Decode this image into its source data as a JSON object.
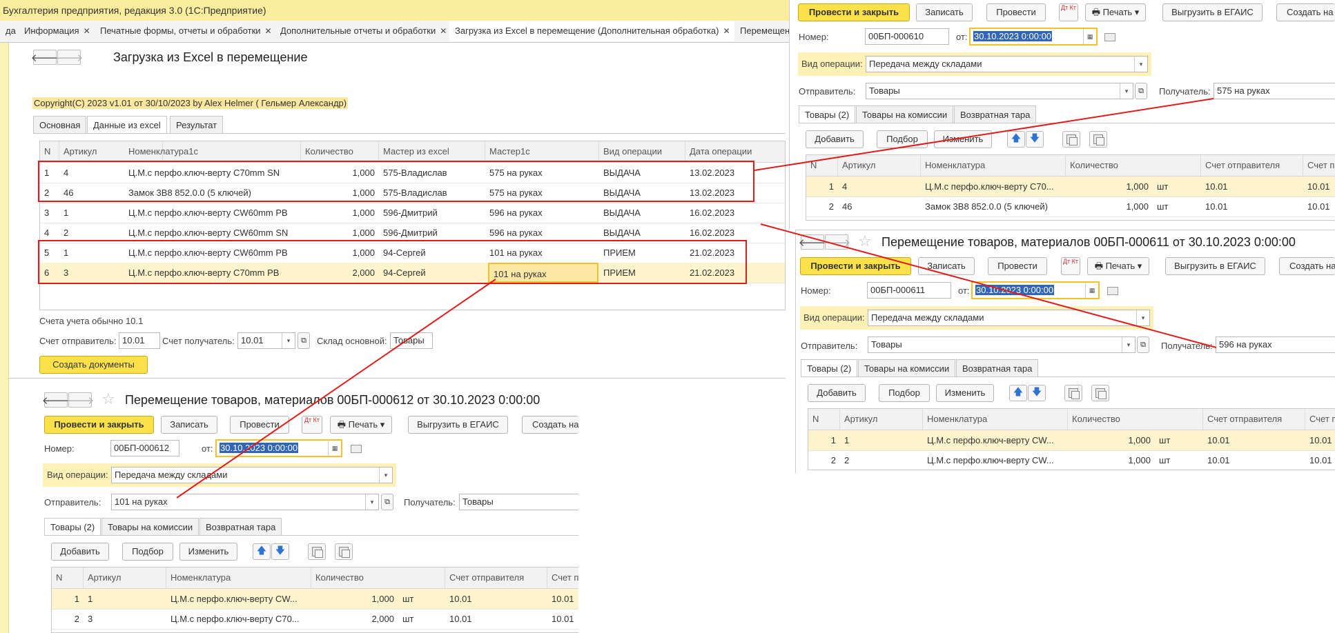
{
  "app_title": "Бухгалтерия предприятия, редакция 3.0  (1С:Предприятие)",
  "tabs": [
    {
      "label": "да"
    },
    {
      "label": "Информация"
    },
    {
      "label": "Печатные формы, отчеты и обработки"
    },
    {
      "label": "Дополнительные отчеты и обработки"
    },
    {
      "label": "Загрузка из Excel в перемещение (Дополнительная обработка)"
    },
    {
      "label": "Перемещен"
    }
  ],
  "loader": {
    "title": "Загрузка из Excel в перемещение",
    "copyright": "Copyright(C)  2023 v1.01 от 30/10/2023  by Alex Helmer ( Гельмер Александр)",
    "tabs": [
      "Основная",
      "Данные из excel",
      "Результат"
    ],
    "columns": [
      "N",
      "Артикул",
      "Номенклатура1с",
      "Количество",
      "Мастер из excel",
      "Мастер1с",
      "Вид операции",
      "Дата операции"
    ],
    "rows": [
      {
        "n": "1",
        "art": "4",
        "nom": "Ц.М.с перфо.ключ-верту C70mm SN",
        "qty": "1,000",
        "mx": "575-Владислав",
        "m1": "575 на руках",
        "op": "ВЫДАЧА",
        "date": "13.02.2023"
      },
      {
        "n": "2",
        "art": "46",
        "nom": "Замок 3В8 852.0.0 (5 ключей)",
        "qty": "1,000",
        "mx": "575-Владислав",
        "m1": "575 на руках",
        "op": "ВЫДАЧА",
        "date": "13.02.2023"
      },
      {
        "n": "3",
        "art": "1",
        "nom": "Ц.М.с перфо.ключ-верту CW60mm PB",
        "qty": "1,000",
        "mx": "596-Дмитрий",
        "m1": "596 на руках",
        "op": "ВЫДАЧА",
        "date": "16.02.2023"
      },
      {
        "n": "4",
        "art": "2",
        "nom": "Ц.М.с перфо.ключ-верту CW60mm SN",
        "qty": "1,000",
        "mx": "596-Дмитрий",
        "m1": "596 на руках",
        "op": "ВЫДАЧА",
        "date": "16.02.2023"
      },
      {
        "n": "5",
        "art": "1",
        "nom": "Ц.М.с перфо.ключ-верту CW60mm PB",
        "qty": "1,000",
        "mx": "94-Сергей",
        "m1": "101 на руках",
        "op": "ПРИЕМ",
        "date": "21.02.2023"
      },
      {
        "n": "6",
        "art": "3",
        "nom": "Ц.М.с перфо.ключ-верту C70mm PB",
        "qty": "2,000",
        "mx": "94-Сергей",
        "m1": "101 на руках",
        "op": "ПРИЕМ",
        "date": "21.02.2023"
      }
    ],
    "note": "Счета учета обычно 10.1",
    "sender_acc_label": "Счет отправитель:",
    "sender_acc": "10.01",
    "recv_acc_label": "Счет получатель:",
    "recv_acc": "10.01",
    "warehouse_label": "Склад основной:",
    "warehouse": "Товары",
    "create_btn": "Создать документы"
  },
  "doc_common": {
    "post_close": "Провести и закрыть",
    "save": "Записать",
    "post": "Провести",
    "dtkt": "Дт Кт",
    "print": "Печать",
    "egais": "Выгрузить в ЕГАИС",
    "create_on": "Создать на",
    "number_label": "Номер:",
    "from_label": "от:",
    "op_label": "Вид операции:",
    "op_value": "Передача между складами",
    "sender_label": "Отправитель:",
    "recv_label": "Получатель:",
    "tab_goods": "Товары (2)",
    "tab_commission": "Товары на комиссии",
    "tab_tare": "Возвратная тара",
    "add": "Добавить",
    "pick": "Подбор",
    "change": "Изменить",
    "cols": [
      "N",
      "Артикул",
      "Номенклатура",
      "Количество",
      "Счет отправителя",
      "Счет п"
    ],
    "unit": "шт"
  },
  "doc610": {
    "number": "00БП-000610",
    "date": "30.10.2023  0:00:00",
    "sender": "Товары",
    "recv": "575 на руках",
    "rows": [
      {
        "n": "1",
        "art": "4",
        "nom": "Ц.М.с перфо.ключ-верту C70...",
        "qty": "1,000",
        "acc": "10.01",
        "acc2": "10.01"
      },
      {
        "n": "2",
        "art": "46",
        "nom": "Замок 3В8 852.0.0 (5 ключей)",
        "qty": "1,000",
        "acc": "10.01",
        "acc2": "10.01"
      }
    ]
  },
  "doc611": {
    "title": "Перемещение товаров, материалов 00БП-000611 от 30.10.2023 0:00:00",
    "number": "00БП-000611",
    "date": "30.10.2023  0:00:00",
    "sender": "Товары",
    "recv": "596 на руках",
    "rows": [
      {
        "n": "1",
        "art": "1",
        "nom": "Ц.М.с перфо.ключ-верту CW...",
        "qty": "1,000",
        "acc": "10.01",
        "acc2": "10.01"
      },
      {
        "n": "2",
        "art": "2",
        "nom": "Ц.М.с перфо.ключ-верту CW...",
        "qty": "1,000",
        "acc": "10.01",
        "acc2": "10.01"
      }
    ]
  },
  "doc612": {
    "title": "Перемещение товаров, материалов 00БП-000612 от 30.10.2023 0:00:00",
    "number": "00БП-000612",
    "date": "30.10.2023  0:00:00",
    "sender": "101 на руках",
    "recv": "Товары",
    "rows": [
      {
        "n": "1",
        "art": "1",
        "nom": "Ц.М.с перфо.ключ-верту CW...",
        "qty": "1,000",
        "acc": "10.01",
        "acc2": "10.01"
      },
      {
        "n": "2",
        "art": "3",
        "nom": "Ц.М.с перфо.ключ-верту C70...",
        "qty": "2,000",
        "acc": "10.01",
        "acc2": "10.01"
      }
    ]
  },
  "colors": {
    "accent_yellow": "#fce14b",
    "annotation_red": "#e01b1b",
    "selection_blue": "#3065b8"
  }
}
